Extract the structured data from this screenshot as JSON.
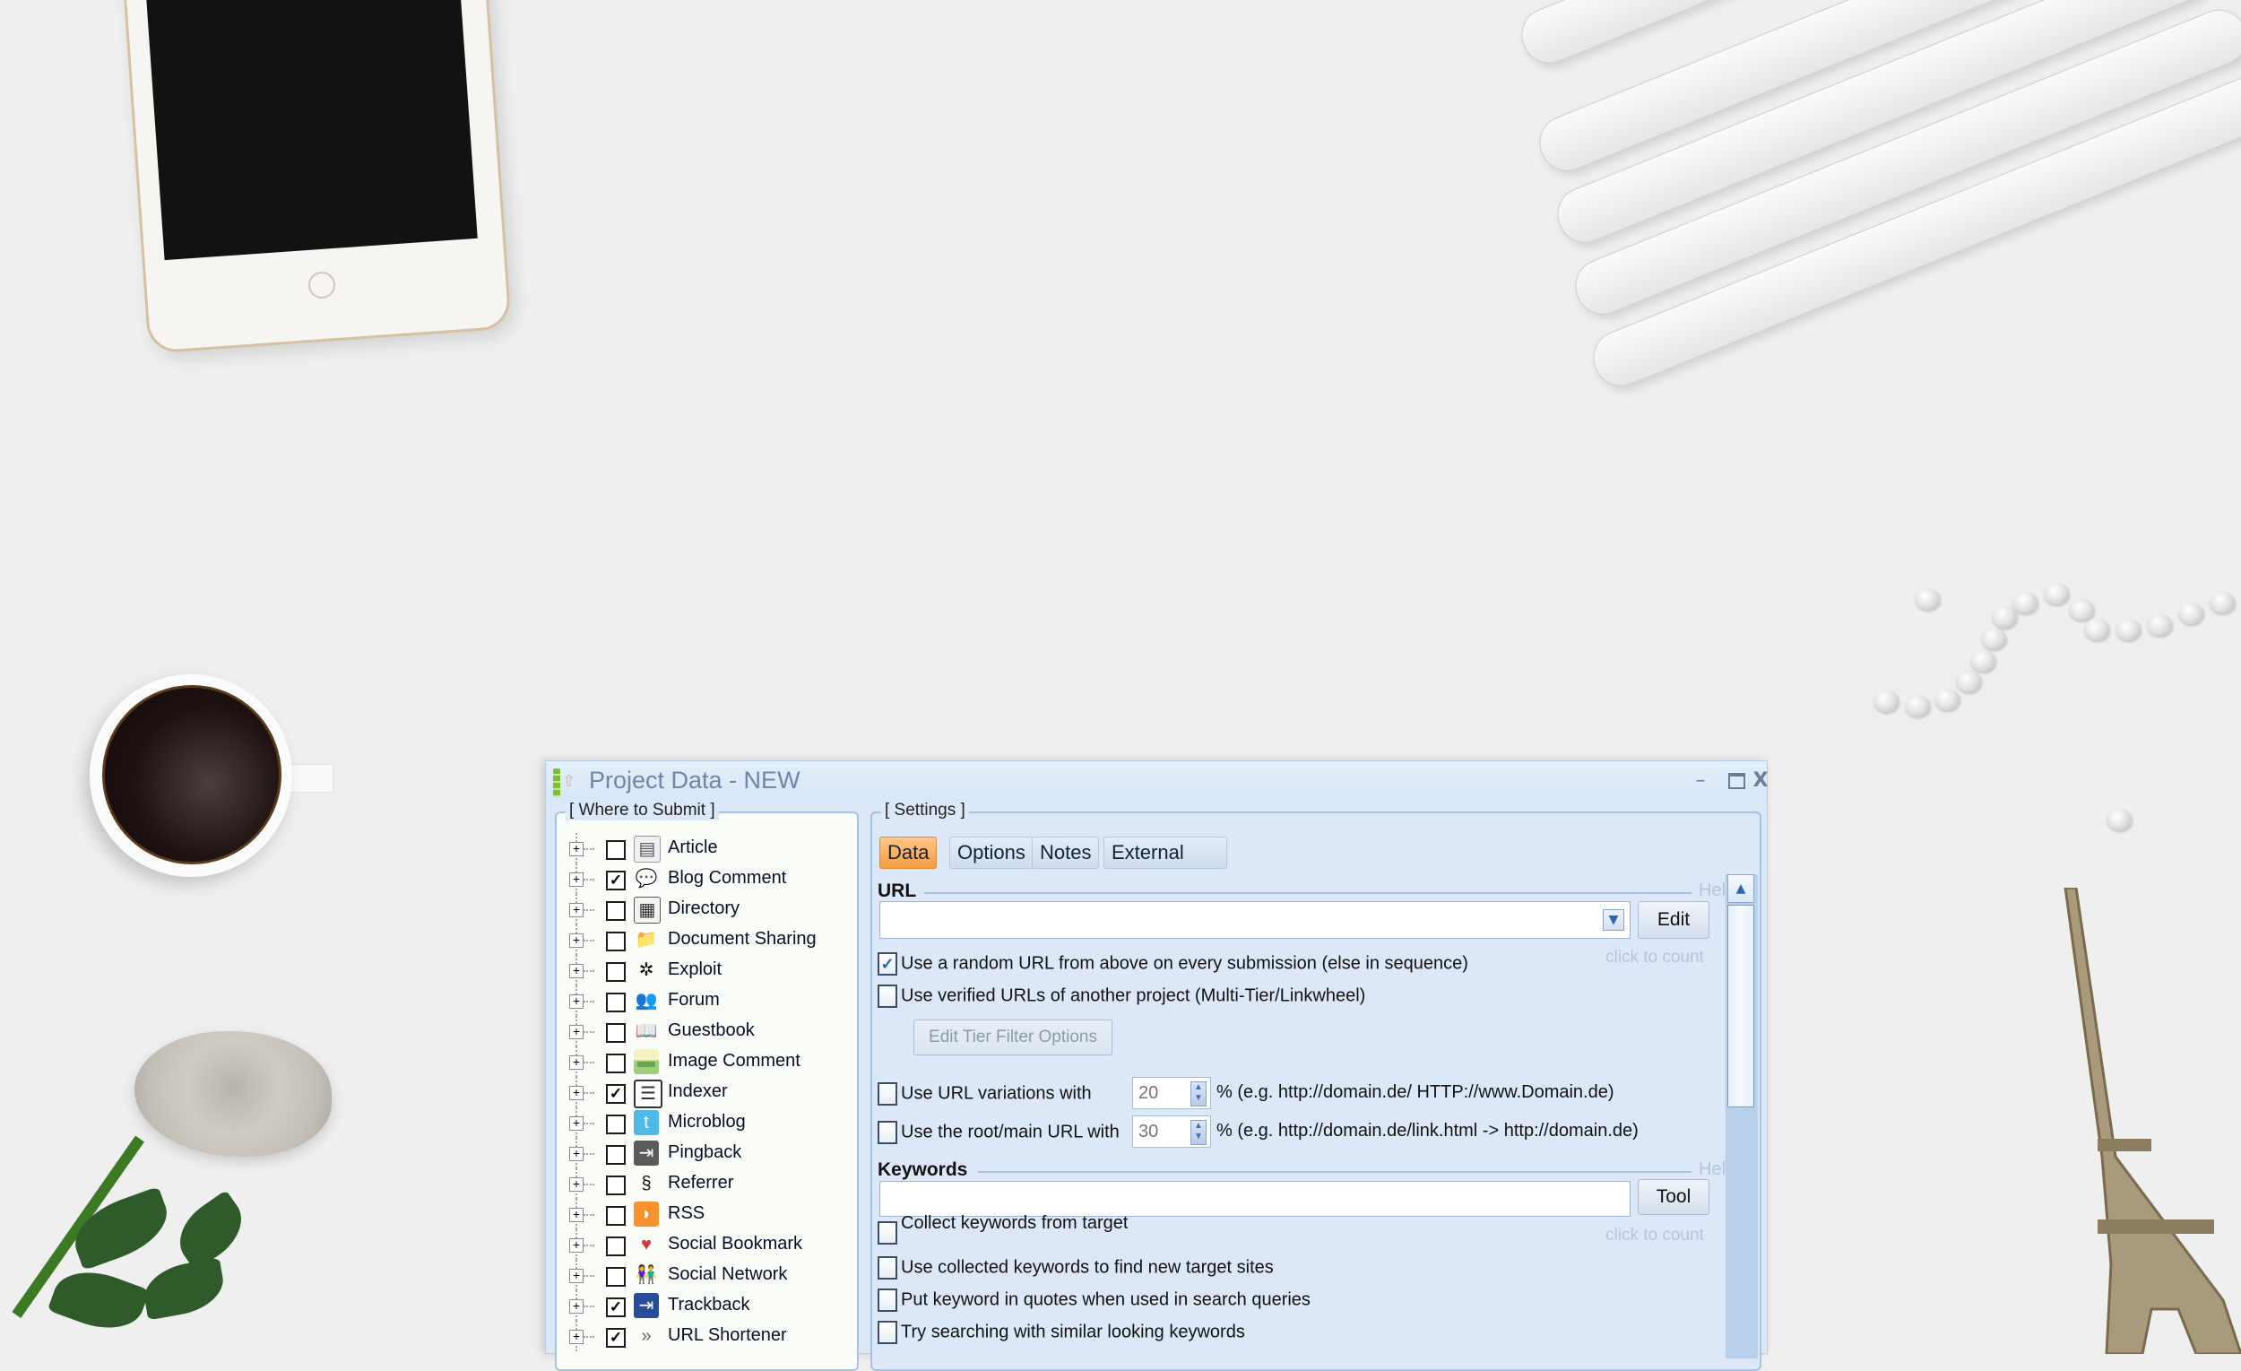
{
  "window": {
    "title": "Project Data - NEW",
    "controls": {
      "minimize": "–",
      "close": "X"
    }
  },
  "where_to_submit": {
    "title": "[ Where to Submit ]",
    "items": [
      {
        "label": "Article",
        "checked": false,
        "icon": "article-icon"
      },
      {
        "label": "Blog Comment",
        "checked": true,
        "icon": "comment-bubble-icon"
      },
      {
        "label": "Directory",
        "checked": false,
        "icon": "directory-icon"
      },
      {
        "label": "Document Sharing",
        "checked": false,
        "icon": "folder-icon"
      },
      {
        "label": "Exploit",
        "checked": false,
        "icon": "bug-icon"
      },
      {
        "label": "Forum",
        "checked": false,
        "icon": "users-icon"
      },
      {
        "label": "Guestbook",
        "checked": false,
        "icon": "book-icon"
      },
      {
        "label": "Image Comment",
        "checked": false,
        "icon": "image-icon"
      },
      {
        "label": "Indexer",
        "checked": true,
        "icon": "indexer-icon"
      },
      {
        "label": "Microblog",
        "checked": false,
        "icon": "twitter-bird-icon"
      },
      {
        "label": "Pingback",
        "checked": false,
        "icon": "pingback-icon"
      },
      {
        "label": "Referrer",
        "checked": false,
        "icon": "referrer-icon"
      },
      {
        "label": "RSS",
        "checked": false,
        "icon": "rss-icon"
      },
      {
        "label": "Social Bookmark",
        "checked": false,
        "icon": "heart-add-icon"
      },
      {
        "label": "Social Network",
        "checked": false,
        "icon": "social-network-icon"
      },
      {
        "label": "Trackback",
        "checked": true,
        "icon": "trackback-icon"
      },
      {
        "label": "URL Shortener",
        "checked": true,
        "icon": "double-chevron-icon"
      }
    ]
  },
  "settings": {
    "title": "[ Settings ]",
    "tabs": [
      {
        "label": "Data",
        "active": true
      },
      {
        "label": "Options",
        "active": false
      },
      {
        "label": "Notes",
        "active": false
      },
      {
        "label": "External",
        "active": false
      }
    ],
    "url": {
      "label": "URL",
      "help": "Help",
      "value": "",
      "edit_button": "Edit",
      "count_link": "click to count",
      "random_url": {
        "label": "Use a random URL from above on every submission (else in sequence)",
        "checked": true
      },
      "verified_urls": {
        "label": "Use verified URLs of another project (Multi-Tier/Linkwheel)",
        "checked": false
      },
      "tier_filter_button": "Edit Tier Filter Options",
      "variations": {
        "label": "Use URL variations with",
        "checked": false,
        "value": "20",
        "example": "% (e.g. http://domain.de/ HTTP://www.Domain.de)"
      },
      "root_url": {
        "label": "Use the root/main URL with",
        "checked": false,
        "value": "30",
        "example": "% (e.g. http://domain.de/link.html -> http://domain.de)"
      }
    },
    "keywords": {
      "label": "Keywords",
      "help": "Help",
      "value": "",
      "tool_button": "Tool",
      "count_link": "click to count",
      "options": [
        {
          "label": "Collect keywords from target",
          "checked": false
        },
        {
          "label": "Use collected keywords to find new target sites",
          "checked": false
        },
        {
          "label": "Put keyword in quotes when used in search queries",
          "checked": false
        },
        {
          "label": "Try searching with similar looking keywords",
          "checked": false
        }
      ]
    }
  },
  "colors": {
    "window_bg": "#dce8f7",
    "active_tab": "#f49d3e",
    "accent_check": "#1d64c8",
    "muted_link": "#b5c5da"
  }
}
